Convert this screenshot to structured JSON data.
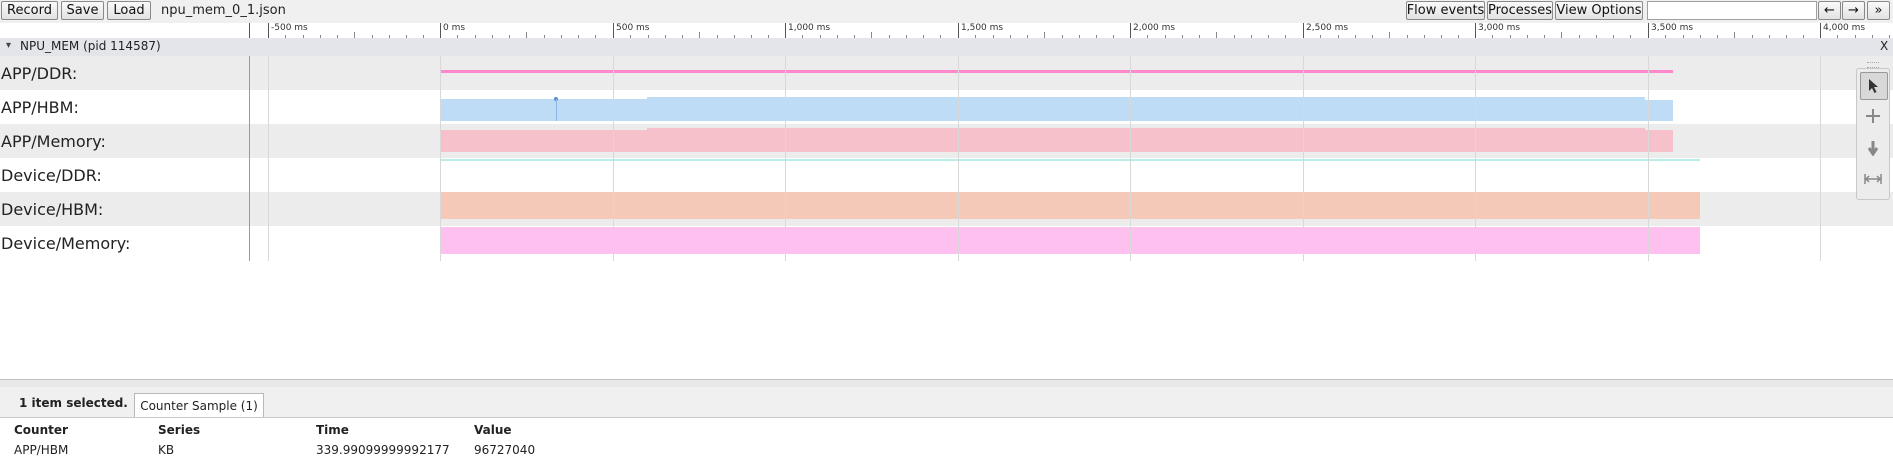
{
  "toolbar": {
    "record_label": "Record",
    "save_label": "Save",
    "load_label": "Load",
    "filename": "npu_mem_0_1.json",
    "flow_events_label": "Flow events",
    "processes_label": "Processes",
    "view_options_label": "View Options",
    "search_value": "",
    "prev_label": "←",
    "next_label": "→",
    "more_label": "»"
  },
  "ruler": {
    "ticks": [
      "-500 ms",
      "0 ms",
      "500 ms",
      "1,000 ms",
      "1,500 ms",
      "2,000 ms",
      "2,500 ms",
      "3,000 ms",
      "3,500 ms",
      "4,000 ms"
    ]
  },
  "process": {
    "title": "NPU_MEM (pid 114587)",
    "expand_glyph": "▾",
    "close_label": "X"
  },
  "tracks": [
    {
      "label": "APP/DDR:",
      "color": "#ff88cc"
    },
    {
      "label": "APP/HBM:",
      "color": "#bfdcf7"
    },
    {
      "label": "APP/Memory:",
      "color": "#f6c1cb"
    },
    {
      "label": "Device/DDR:",
      "color": "#b8eee6"
    },
    {
      "label": "Device/HBM:",
      "color": "#f4c9b8"
    },
    {
      "label": "Device/Memory:",
      "color": "#fdc0ef"
    }
  ],
  "tools": {
    "select_icon": "arrow-cursor-icon",
    "pan_icon": "move-cross-icon",
    "zoom_icon": "zoom-vertical-icon",
    "timing_icon": "timing-range-icon"
  },
  "analysis": {
    "selection_info": "1 item selected.",
    "tab_label": "Counter Sample (1)",
    "headers": {
      "counter": "Counter",
      "series": "Series",
      "time": "Time",
      "value": "Value"
    },
    "row": {
      "counter": "APP/HBM",
      "series": "KB",
      "time": "339.99099999992177",
      "value": "96727040"
    }
  }
}
